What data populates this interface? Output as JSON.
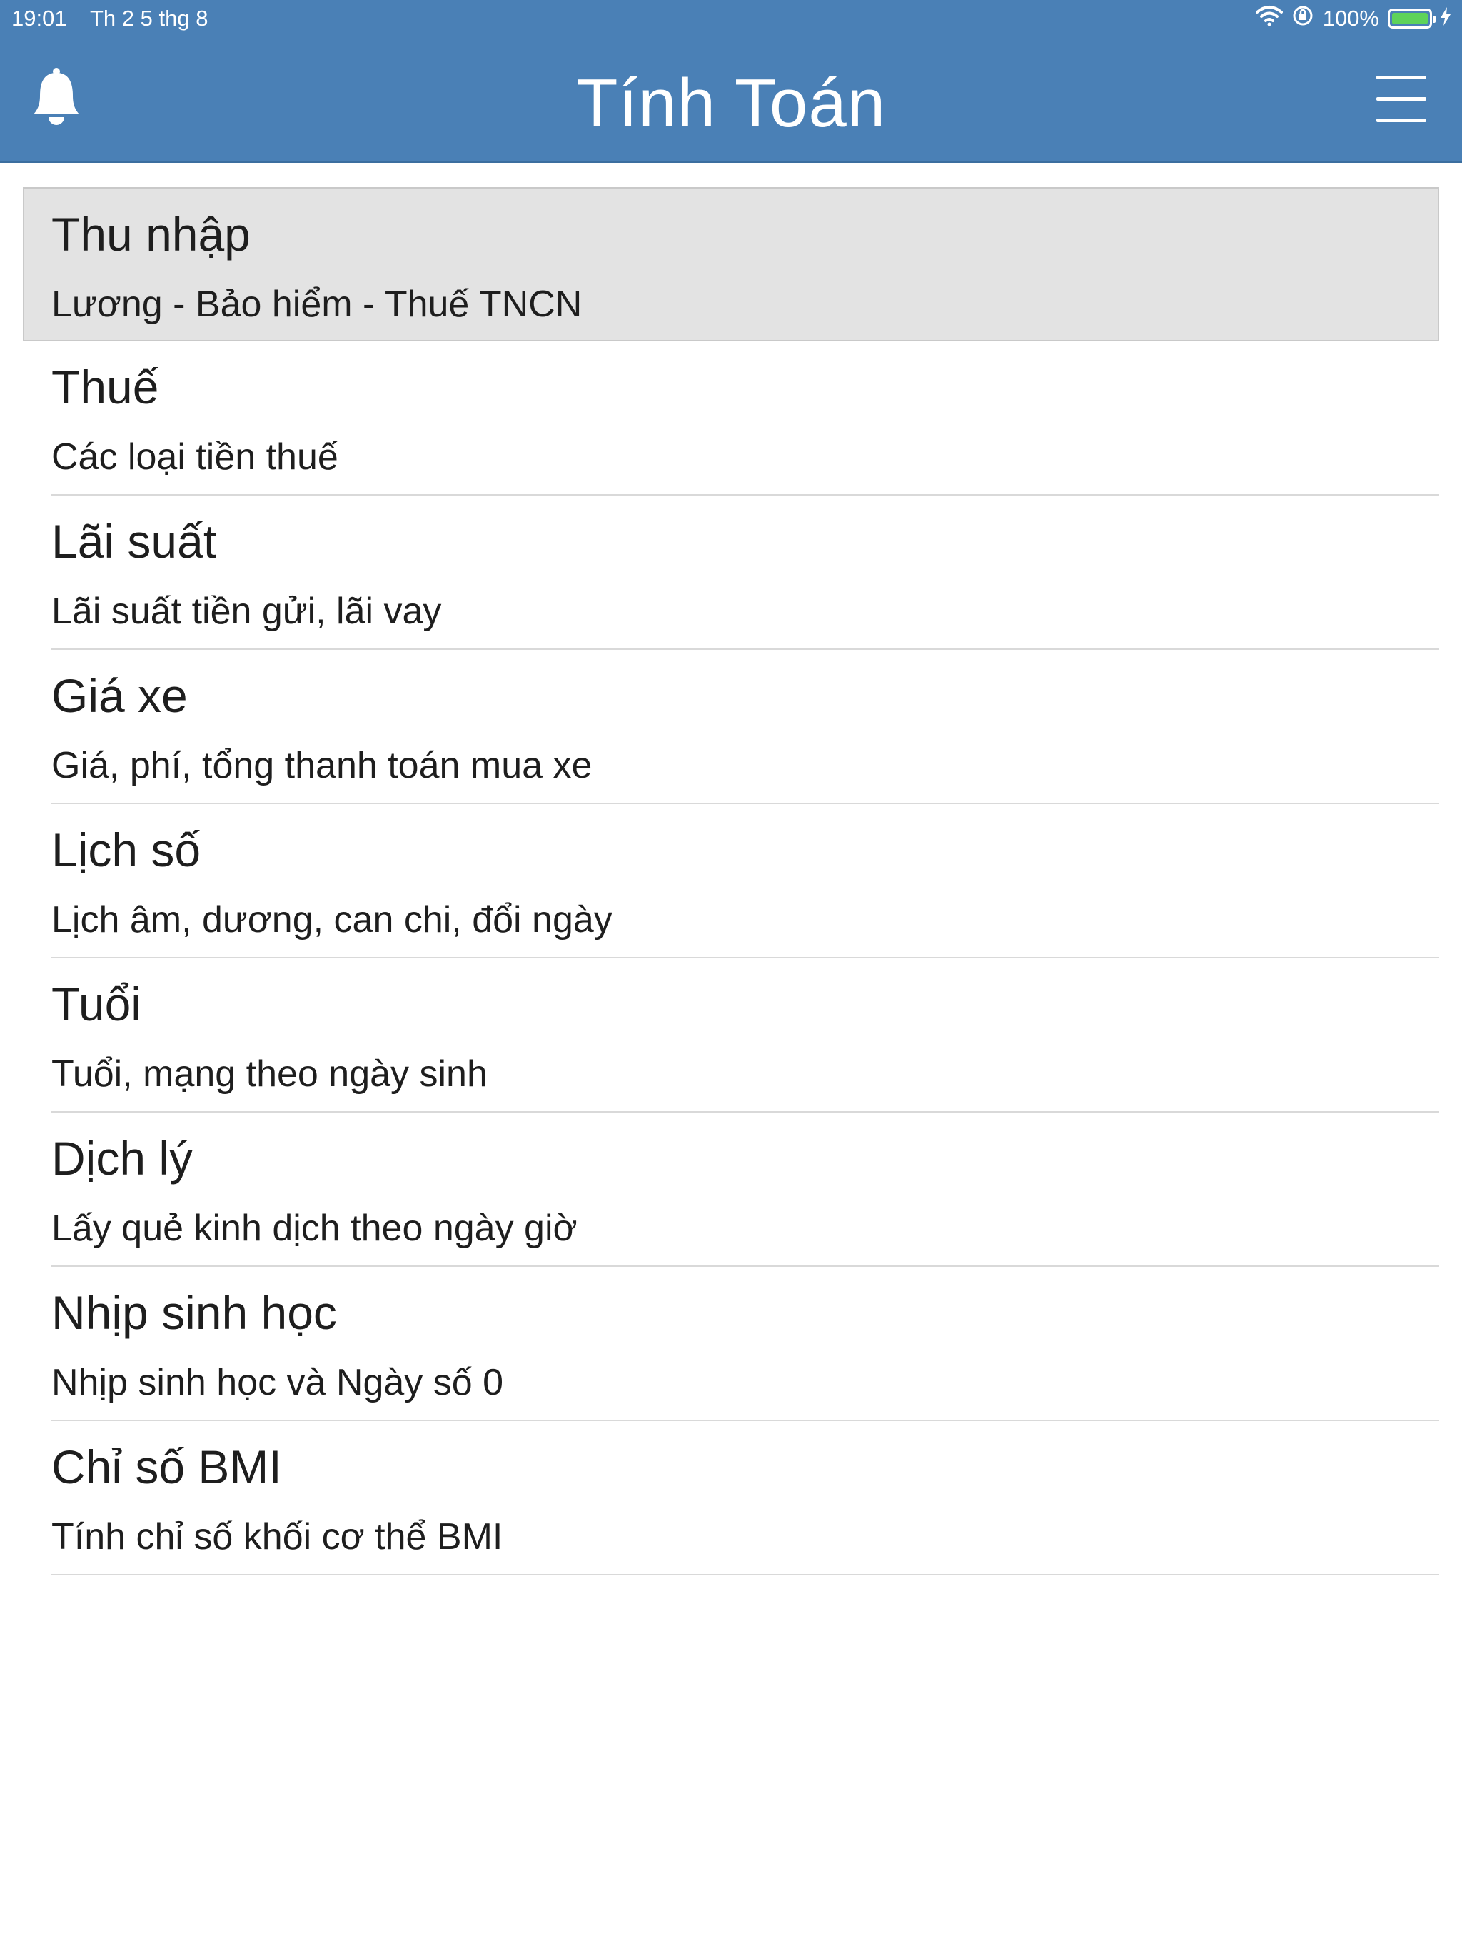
{
  "status_bar": {
    "time": "19:01",
    "date": "Th 2 5 thg 8",
    "battery_percent": "100%",
    "battery_level": 1.0,
    "battery_color": "#5ed35a"
  },
  "header": {
    "title": "Tính Toán",
    "left_icon": "bell-icon",
    "right_icon": "hamburger-menu-icon",
    "background": "#4a80b6"
  },
  "items": [
    {
      "title": "Thu nhập",
      "subtitle": "Lương - Bảo hiểm - Thuế TNCN",
      "selected": true
    },
    {
      "title": "Thuế",
      "subtitle": "Các loại tiền thuế"
    },
    {
      "title": "Lãi suất",
      "subtitle": "Lãi suất tiền gửi, lãi vay"
    },
    {
      "title": "Giá xe",
      "subtitle": "Giá, phí, tổng thanh toán mua xe"
    },
    {
      "title": "Lịch số",
      "subtitle": "Lịch âm, dương, can chi, đổi ngày"
    },
    {
      "title": "Tuổi",
      "subtitle": "Tuổi, mạng theo ngày sinh"
    },
    {
      "title": "Dịch lý",
      "subtitle": "Lấy quẻ kinh dịch theo ngày giờ"
    },
    {
      "title": "Nhịp sinh học",
      "subtitle": "Nhịp sinh học và Ngày số 0"
    },
    {
      "title": "Chỉ số BMI",
      "subtitle": "Tính chỉ số khối cơ thể BMI"
    }
  ]
}
